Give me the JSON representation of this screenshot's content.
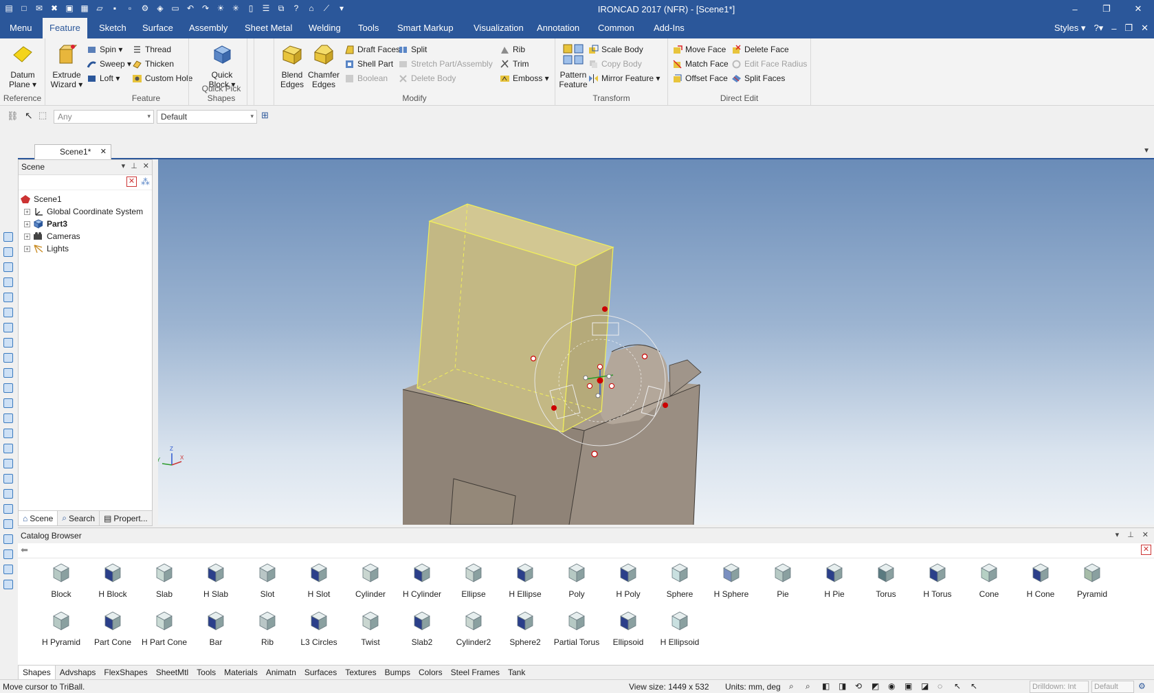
{
  "window": {
    "title": "IRONCAD 2017 (NFR) - [Scene1*]",
    "controls": [
      "–",
      "❐",
      "✕"
    ]
  },
  "menu_tabs": [
    "Menu",
    "Feature",
    "Sketch",
    "Surface",
    "Assembly",
    "Sheet Metal",
    "Welding",
    "Tools",
    "Smart Markup",
    "Visualization",
    "Annotation",
    "Common",
    "Add-Ins"
  ],
  "active_tab": "Feature",
  "tabs_right": {
    "styles": "Styles ▾"
  },
  "ribbon": {
    "reference": {
      "label": "Reference",
      "datum_plane": "Datum Plane ▾"
    },
    "feature": {
      "label": "Feature",
      "extrude_wizard": "Extrude Wizard ▾",
      "spin": "Spin ▾",
      "sweep": "Sweep ▾",
      "loft": "Loft ▾",
      "thread": "Thread",
      "thicken": "Thicken",
      "custom_hole": "Custom Hole"
    },
    "quick_pick": {
      "label": "Quick Pick Shapes",
      "quick_block": "Quick Block ▾"
    },
    "modify": {
      "label": "Modify",
      "blend_edges": "Blend Edges",
      "chamfer_edges": "Chamfer Edges",
      "draft_faces": "Draft Faces",
      "shell_part": "Shell Part",
      "boolean": "Boolean",
      "split": "Split",
      "stretch": "Stretch Part/Assembly",
      "delete_body": "Delete Body",
      "rib": "Rib",
      "trim": "Trim",
      "emboss": "Emboss ▾"
    },
    "transform": {
      "label": "Transform",
      "pattern_feature": "Pattern Feature",
      "scale_body": "Scale Body",
      "copy_body": "Copy Body",
      "mirror_feature": "Mirror Feature ▾"
    },
    "direct_edit": {
      "label": "Direct Edit",
      "move_face": "Move Face",
      "match_face": "Match Face",
      "offset_face": "Offset Face",
      "delete_face": "Delete Face",
      "edit_face_radius": "Edit Face Radius",
      "split_faces": "Split Faces"
    }
  },
  "selection_bar": {
    "filter_value": "Any",
    "style_value": "Default"
  },
  "document_tab": "Scene1*",
  "scene_panel": {
    "title": "Scene",
    "tree": [
      {
        "label": "Scene1",
        "bold": false
      },
      {
        "label": "Global Coordinate System",
        "bold": false
      },
      {
        "label": "Part3",
        "bold": true
      },
      {
        "label": "Cameras",
        "bold": false
      },
      {
        "label": "Lights",
        "bold": false
      }
    ],
    "tabs": [
      "Scene",
      "Search",
      "Propert..."
    ]
  },
  "viewport": {
    "axis_labels": {
      "z": "Z",
      "x": "X",
      "y": "Y"
    }
  },
  "catalog": {
    "title": "Catalog Browser",
    "shapes_row1": [
      "Block",
      "H Block",
      "Slab",
      "H Slab",
      "Slot",
      "H Slot",
      "Cylinder",
      "H Cylinder",
      "Ellipse",
      "H Ellipse",
      "Poly",
      "H Poly",
      "Sphere",
      "H Sphere",
      "Pie",
      "H Pie",
      "Torus",
      "H Torus",
      "Cone",
      "H Cone",
      "Pyramid"
    ],
    "shapes_row2": [
      "H Pyramid",
      "Part Cone",
      "H Part Cone",
      "Bar",
      "Rib",
      "L3 Circles",
      "Twist",
      "Slab2",
      "Cylinder2",
      "Sphere2",
      "Partial Torus",
      "Ellipsoid",
      "H Ellipsoid"
    ],
    "tabs": [
      "Shapes",
      "Advshaps",
      "FlexShapes",
      "SheetMtl",
      "Tools",
      "Materials",
      "Animatn",
      "Surfaces",
      "Textures",
      "Bumps",
      "Colors",
      "Steel Frames",
      "Tank"
    ]
  },
  "status": {
    "message": "Move cursor to TriBall.",
    "view_size": "View size: 1449 x  532",
    "units": "Units: mm, deg",
    "drilldown": "Drilldown: Int",
    "default": "Default"
  },
  "colors": {
    "accent": "#2b579a",
    "part_body": "#8f8377",
    "selected_face": "#c9bd84"
  }
}
